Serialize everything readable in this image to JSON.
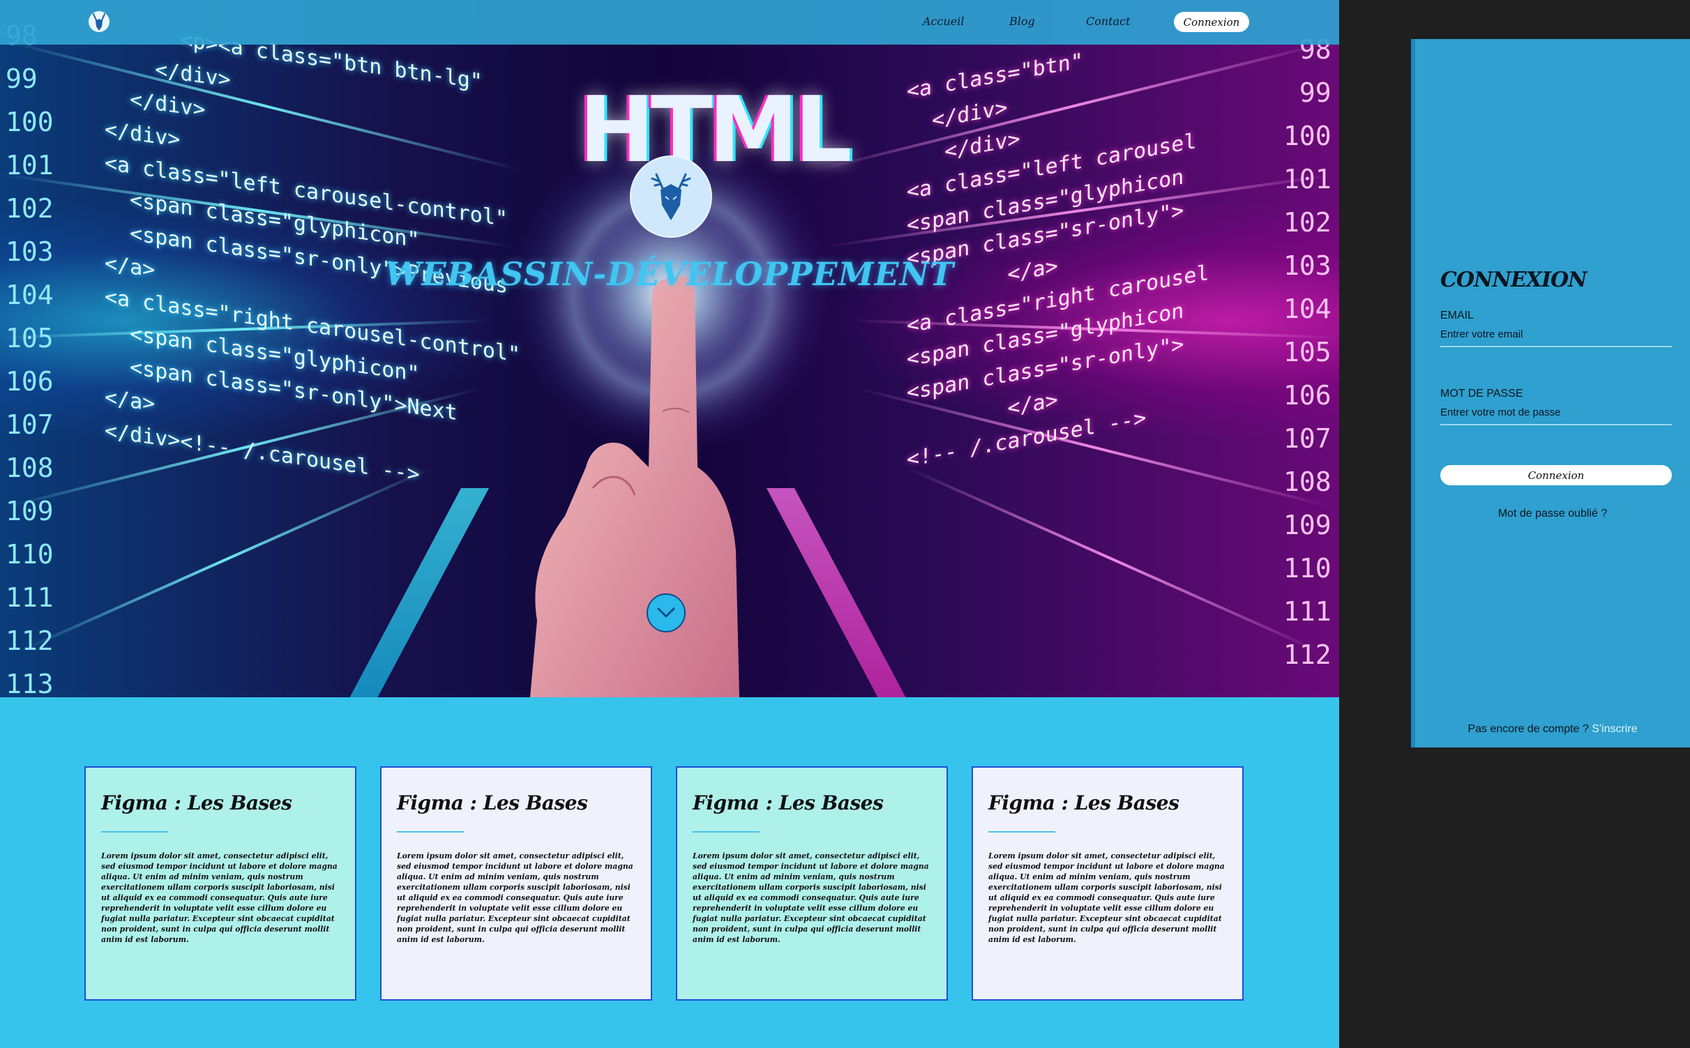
{
  "nav": {
    "links": [
      "Accueil",
      "Blog",
      "Contact"
    ],
    "login_button": "Connexion"
  },
  "hero": {
    "heading_image_text": "HTML",
    "brand": "WEBASSIN-DÉVELOPPEMENT",
    "scroll_icon": "chevron-down-icon"
  },
  "cards": [
    {
      "title": "Figma : Les Bases",
      "body": "Lorem ipsum dolor sit amet, consectetur adipisci elit, sed eiusmod tempor incidunt ut labore et dolore magna aliqua. Ut enim ad minim veniam, quis nostrum exercitationem ullam corporis suscipit laboriosam, nisi ut aliquid ex ea commodi consequatur. Quis aute iure reprehenderit in voluptate velit esse cillum dolore eu fugiat nulla pariatur. Excepteur sint obcaecat cupiditat non proident, sunt in culpa qui officia deserunt mollit anim id est laborum.",
      "bg": "#aef0ea"
    },
    {
      "title": "Figma : Les Bases",
      "body": "Lorem ipsum dolor sit amet, consectetur adipisci elit, sed eiusmod tempor incidunt ut labore et dolore magna aliqua. Ut enim ad minim veniam, quis nostrum exercitationem ullam corporis suscipit laboriosam, nisi ut aliquid ex ea commodi consequatur. Quis aute iure reprehenderit in voluptate velit esse cillum dolore eu fugiat nulla pariatur. Excepteur sint obcaecat cupiditat non proident, sunt in culpa qui officia deserunt mollit anim id est laborum.",
      "bg": "#eff2fd"
    },
    {
      "title": "Figma : Les Bases",
      "body": "Lorem ipsum dolor sit amet, consectetur adipisci elit, sed eiusmod tempor incidunt ut labore et dolore magna aliqua. Ut enim ad minim veniam, quis nostrum exercitationem ullam corporis suscipit laboriosam, nisi ut aliquid ex ea commodi consequatur. Quis aute iure reprehenderit in voluptate velit esse cillum dolore eu fugiat nulla pariatur. Excepteur sint obcaecat cupiditat non proident, sunt in culpa qui officia deserunt mollit anim id est laborum.",
      "bg": "#aef0ea"
    },
    {
      "title": "Figma : Les Bases",
      "body": "Lorem ipsum dolor sit amet, consectetur adipisci elit, sed eiusmod tempor incidunt ut labore et dolore magna aliqua. Ut enim ad minim veniam, quis nostrum exercitationem ullam corporis suscipit laboriosam, nisi ut aliquid ex ea commodi consequatur. Quis aute iure reprehenderit in voluptate velit esse cillum dolore eu fugiat nulla pariatur. Excepteur sint obcaecat cupiditat non proident, sunt in culpa qui officia deserunt mollit anim id est laborum.",
      "bg": "#eff2fd"
    }
  ],
  "login_panel": {
    "title": "CONNEXION",
    "email_label": "EMAIL",
    "email_placeholder": "Entrer votre email",
    "password_label": "MOT DE PASSE",
    "password_placeholder": "Entrer votre mot de passe",
    "submit": "Connexion",
    "forgot": "Mot de passe oublié ?",
    "signup_prompt": "Pas encore de compte ?",
    "signup_link": "S'inscrire"
  },
  "colors": {
    "page_bg": "#36c4ec",
    "navbar": "#30a3d2",
    "panel": "#2fa0cf",
    "outer_bg": "#1f1f1f",
    "card_border": "#1d4fd8",
    "brand_text": "#40c6f2"
  }
}
